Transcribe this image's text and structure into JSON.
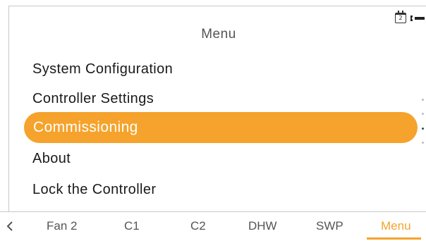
{
  "status": {
    "calendar_icon": "calendar-icon",
    "calendar_day": "2",
    "service_icon": "wrench-icon"
  },
  "page": {
    "title": "Menu"
  },
  "menu": {
    "items": [
      {
        "label": "System Configuration"
      },
      {
        "label": "Controller Settings"
      },
      {
        "label": "Commissioning",
        "selected": true
      },
      {
        "label": "About"
      },
      {
        "label": "Lock the Controller"
      }
    ]
  },
  "scroll": {
    "pages": 4,
    "current": 3
  },
  "nav": {
    "back_icon": "chevron-left-icon",
    "tabs": [
      {
        "label": "Fan 2"
      },
      {
        "label": "C1"
      },
      {
        "label": "C2"
      },
      {
        "label": "DHW"
      },
      {
        "label": "SWP"
      },
      {
        "label": "Menu",
        "active": true
      }
    ]
  },
  "colors": {
    "accent": "#f5a32c",
    "text": "#1a1a1a",
    "muted": "#555555",
    "rule": "#c8c8c8"
  }
}
